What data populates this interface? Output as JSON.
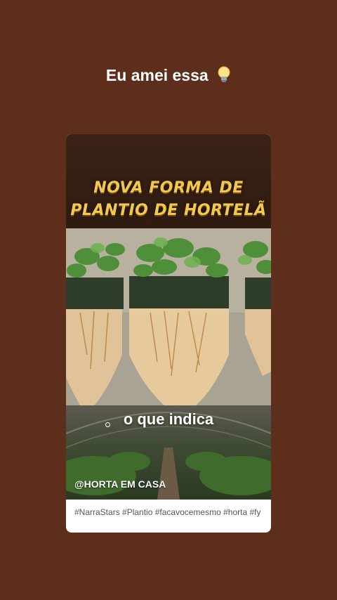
{
  "story": {
    "caption": "Eu amei essa",
    "caption_icon": "lightbulb-icon"
  },
  "video_card": {
    "headline_line1": "NOVA FORMA DE",
    "headline_line2": "PLANTIO DE HORTELÃ",
    "subtitle": "o que indica",
    "watermark": "@HORTA EM CASA",
    "hashtags": "#NarraStars #Plantio #facavocemesmo #horta #fy"
  },
  "colors": {
    "background": "#5c2e1b",
    "headline": "#f2c94c",
    "card_header": "#3b2216"
  }
}
